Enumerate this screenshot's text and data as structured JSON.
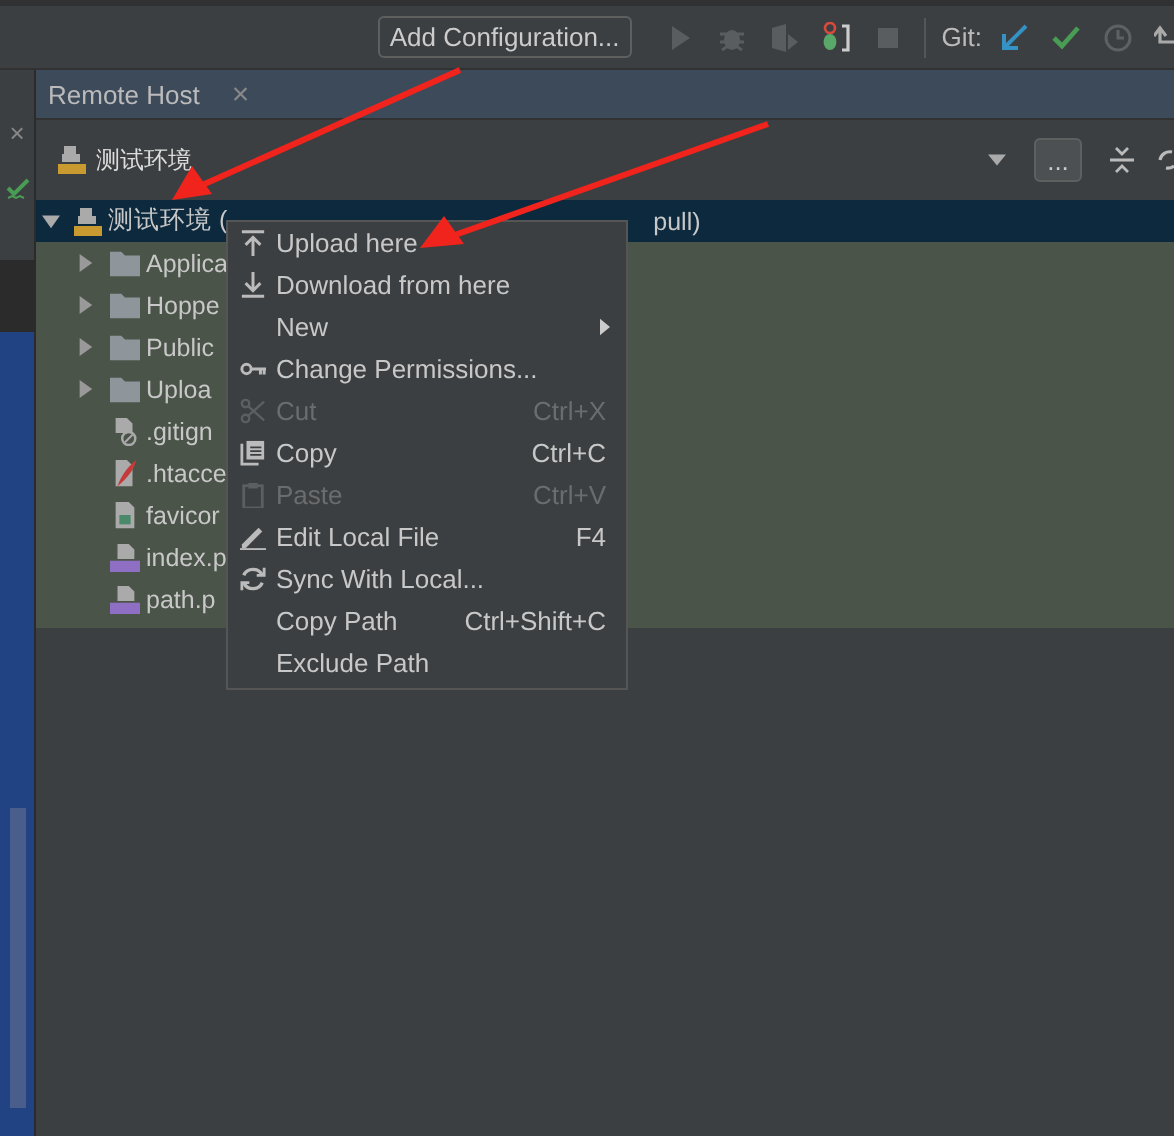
{
  "toolbar": {
    "run_config": "Add Configuration...",
    "vcs_label": "Git:"
  },
  "side_strip": {
    "close": "×"
  },
  "tool_window": {
    "title": "Remote Host",
    "close": "×"
  },
  "host_selector": {
    "name": "测试环境",
    "more": "..."
  },
  "tree": {
    "label": "测试环境 (",
    "tail": "pull)",
    "expanded": true,
    "selected": true,
    "children": [
      {
        "name": "Applica",
        "kind": "folder",
        "expanded": false
      },
      {
        "name": "Hoppe",
        "kind": "folder",
        "expanded": false
      },
      {
        "name": "Public",
        "kind": "folder",
        "expanded": false
      },
      {
        "name": "Uploa",
        "kind": "folder",
        "expanded": false
      },
      {
        "name": ".gitign",
        "kind": "ignore"
      },
      {
        "name": ".htacce",
        "kind": "feather"
      },
      {
        "name": "favicor",
        "kind": "image"
      },
      {
        "name": "index.p",
        "kind": "php"
      },
      {
        "name": "path.p",
        "kind": "php"
      }
    ]
  },
  "context_menu": [
    {
      "label": "Upload here",
      "kind": "upload",
      "disabled": false
    },
    {
      "label": "Download from here",
      "kind": "download",
      "disabled": false
    },
    {
      "label": "New",
      "submenu": true,
      "disabled": false
    },
    {
      "label": "Change Permissions...",
      "kind": "key",
      "disabled": false
    },
    {
      "label": "Cut",
      "kind": "cut",
      "shortcut": "Ctrl+X",
      "disabled": true
    },
    {
      "label": "Copy",
      "kind": "copy",
      "shortcut": "Ctrl+C",
      "disabled": false
    },
    {
      "label": "Paste",
      "kind": "paste",
      "shortcut": "Ctrl+V",
      "disabled": true
    },
    {
      "label": "Edit Local File",
      "kind": "pencil",
      "shortcut": "F4",
      "disabled": false
    },
    {
      "label": "Sync With Local...",
      "kind": "sync",
      "disabled": false
    },
    {
      "label": "Copy Path",
      "shortcut": "Ctrl+Shift+C",
      "disabled": false
    },
    {
      "label": "Exclude Path",
      "disabled": false
    }
  ]
}
